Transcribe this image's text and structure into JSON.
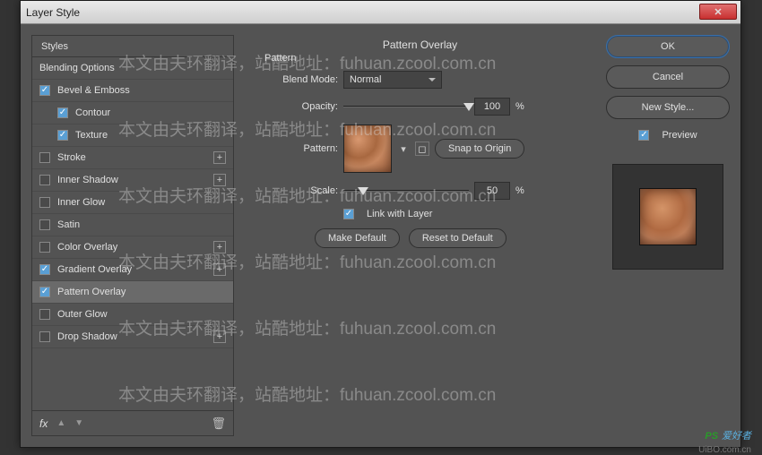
{
  "window": {
    "title": "Layer Style",
    "close": "✕"
  },
  "styles": {
    "header": "Styles",
    "blending": "Blending Options",
    "bevel": "Bevel & Emboss",
    "contour": "Contour",
    "texture": "Texture",
    "stroke": "Stroke",
    "innerShadow": "Inner Shadow",
    "innerGlow": "Inner Glow",
    "satin": "Satin",
    "colorOverlay": "Color Overlay",
    "gradientOverlay": "Gradient Overlay",
    "patternOverlay": "Pattern Overlay",
    "outerGlow": "Outer Glow",
    "dropShadow": "Drop Shadow",
    "fx": "fx"
  },
  "panel": {
    "title": "Pattern Overlay",
    "subtitle": "Pattern",
    "blendMode": "Blend Mode:",
    "blendValue": "Normal",
    "opacity": "Opacity:",
    "opacityVal": "100",
    "pct": "%",
    "pattern": "Pattern:",
    "snap": "Snap to Origin",
    "scale": "Scale:",
    "scaleVal": "50",
    "link": "Link with Layer",
    "makeDefault": "Make Default",
    "resetDefault": "Reset to Default"
  },
  "actions": {
    "ok": "OK",
    "cancel": "Cancel",
    "newStyle": "New Style...",
    "preview": "Preview"
  },
  "watermark": {
    "text": "本文由夫环翻译，站酷地址：fuhuan.zcool.com.cn"
  },
  "brand": {
    "ps": "PS",
    "name": "爱好者",
    "url": "UiBO.com.cn"
  }
}
